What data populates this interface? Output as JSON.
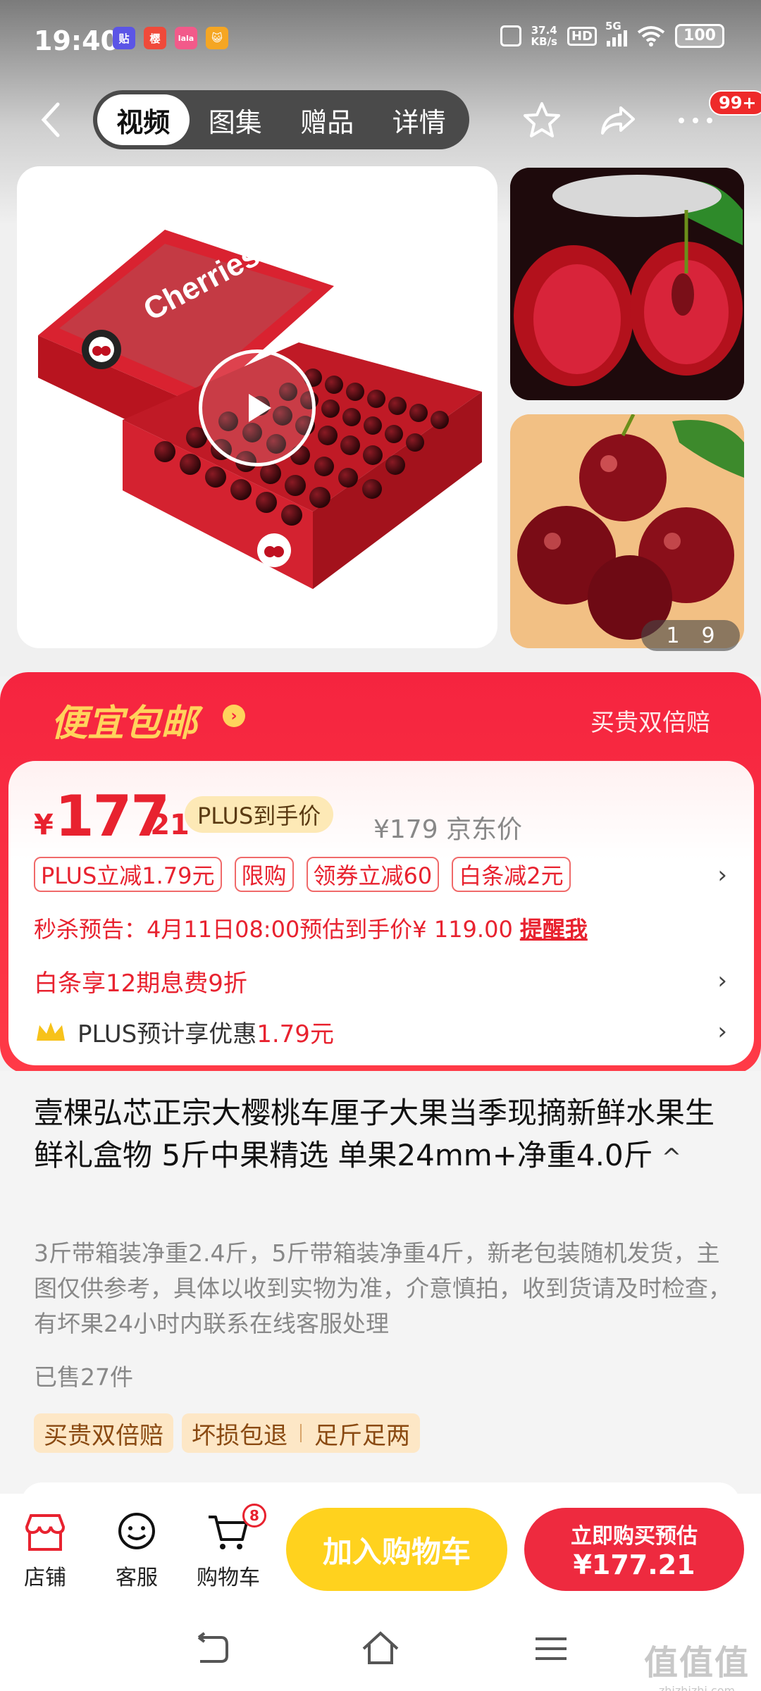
{
  "status": {
    "time": "19:40",
    "apps": [
      {
        "label": "贴",
        "color": "#5b55e6"
      },
      {
        "label": "樱",
        "color": "#f04a3a"
      },
      {
        "label": "lala",
        "color": "#f25a8a"
      },
      {
        "label": "😺",
        "color": "#f5a623"
      }
    ],
    "speed_value": "37.4",
    "speed_unit": "KB/s",
    "hd": "HD",
    "network": "5G",
    "battery": "100"
  },
  "nav": {
    "tabs": [
      "视频",
      "图集",
      "赠品",
      "详情"
    ],
    "active_tab": 0,
    "badge": "99+"
  },
  "gallery": {
    "counter_current": "1",
    "counter_total": "9",
    "box_label": "Cherries"
  },
  "promo": {
    "title": "便宜包邮",
    "right_text": "买贵双倍赔"
  },
  "price": {
    "currency": "¥",
    "integer": "177",
    "decimal": ".21",
    "plus_tag": "PLUS到手价",
    "jd_price": "¥179 京东价"
  },
  "coupons": [
    "PLUS立减1.79元",
    "限购",
    "领券立减60",
    "白条减2元"
  ],
  "seckill": {
    "text": "秒杀预告：4月11日08:00预估到手价¥ 119.00",
    "remind": "提醒我"
  },
  "baitiao": "白条享12期息费9折",
  "plus_benefit": {
    "prefix": "PLUS预计享优惠",
    "amount": "1.79元"
  },
  "product": {
    "title": "壹棵弘芯正宗大樱桃车厘子大果当季现摘新鲜水果生鲜礼盒物 5斤中果精选 单果24mm+净重4.0斤",
    "caret": "^",
    "description": "3斤带箱装净重2.4斤，5斤带箱装净重4斤，新老包装随机发货，主图仅供参考，具体以收到实物为准，介意慎拍，收到货请及时检查，有坏果24小时内联系在线客服处理",
    "sold": "已售27件",
    "tags": [
      "买贵双倍赔",
      "坏损包退",
      "足斤足两"
    ]
  },
  "bottom_bar": {
    "shop": "店铺",
    "service": "客服",
    "cart": "购物车",
    "cart_count": "8",
    "add_to_cart": "加入购物车",
    "buy_now_line1": "立即购买预估",
    "buy_now_line2": "¥177.21"
  },
  "watermark": {
    "main": "值值值",
    "sub": "zhizhizhi.com"
  },
  "colors": {
    "accent_red": "#e8222f",
    "promo_red": "#f5243f",
    "cart_yellow": "#ffd21e",
    "promo_gold": "#ffd35c"
  }
}
